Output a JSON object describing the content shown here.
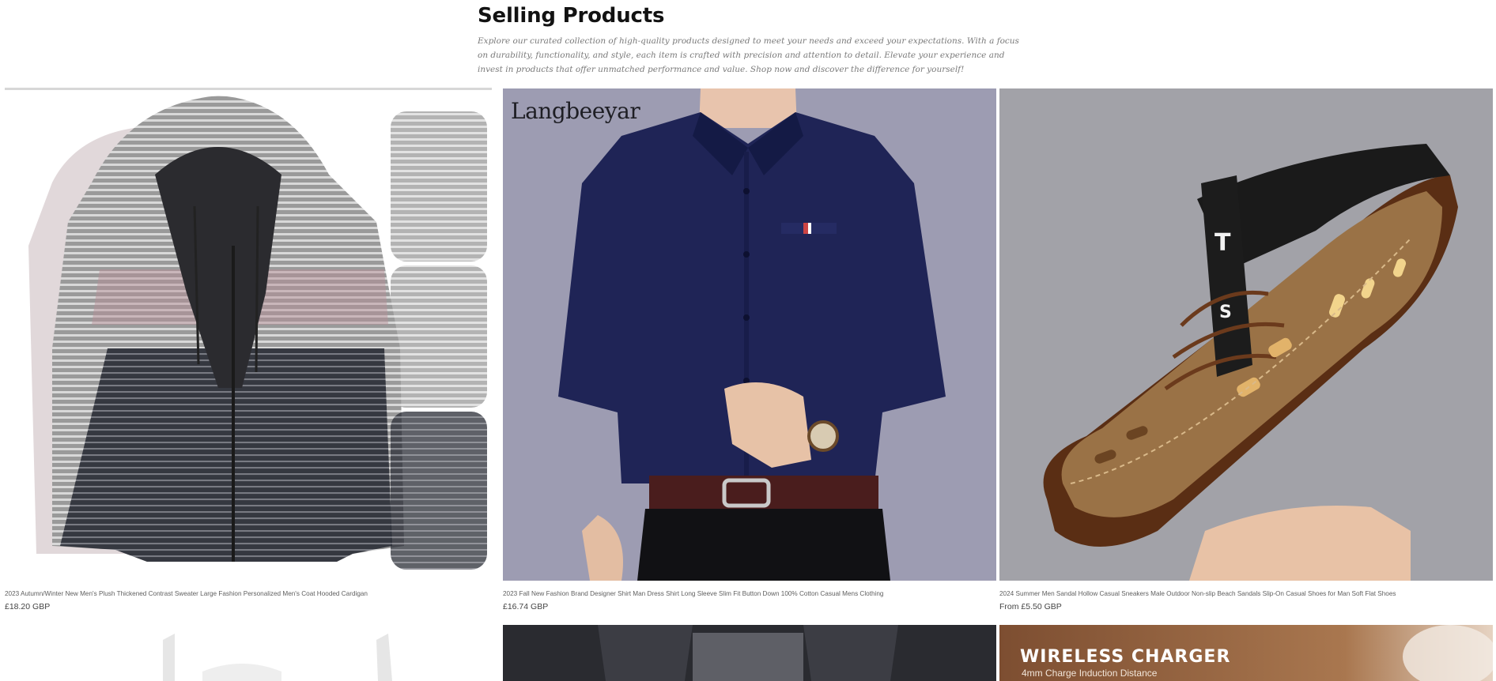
{
  "section": {
    "title": "Selling Products",
    "description": "Explore our curated collection of high-quality products designed to meet your needs and exceed your expectations. With a focus on durability, functionality, and style, each item is crafted with precision and attention to detail. Elevate your experience and invest in products that offer unmatched performance and value. Shop now and discover the difference for yourself!"
  },
  "products": [
    {
      "title": "2023 Autumn/Winter New Men's Plush Thickened Contrast Sweater Large Fashion Personalized Men's Coat Hooded Cardigan",
      "price": "£18.20 GBP",
      "image": "hooded-cardigan-image"
    },
    {
      "title": "2023 Fall New Fashion Brand Designer Shirt Man Dress Shirt Long Sleeve Slim Fit Button Down 100% Cotton Casual Mens Clothing",
      "price": "£16.74 GBP",
      "image": "navy-dress-shirt-image",
      "brand_mark": "Langbeeyar"
    },
    {
      "title": "2024 Summer Men Sandal Hollow Casual Sneakers Male Outdoor Non-slip Beach Sandals Slip-On Casual Shoes for Man Soft Flat Shoes",
      "price": "From £5.50 GBP",
      "image": "brown-sandal-shoe-image"
    }
  ],
  "partial_products": [
    {
      "image": "product-image-partial"
    },
    {
      "image": "trousers-image-partial"
    },
    {
      "image": "wireless-charger-image-partial",
      "banner_title": "WIRELESS CHARGER",
      "banner_sub": "4mm Charge Induction Distance"
    }
  ],
  "colors": {
    "background": "#ffffff",
    "heading": "#121212",
    "description": "#7a7a7a",
    "product_title": "#5f5f5f",
    "price": "#444444"
  }
}
